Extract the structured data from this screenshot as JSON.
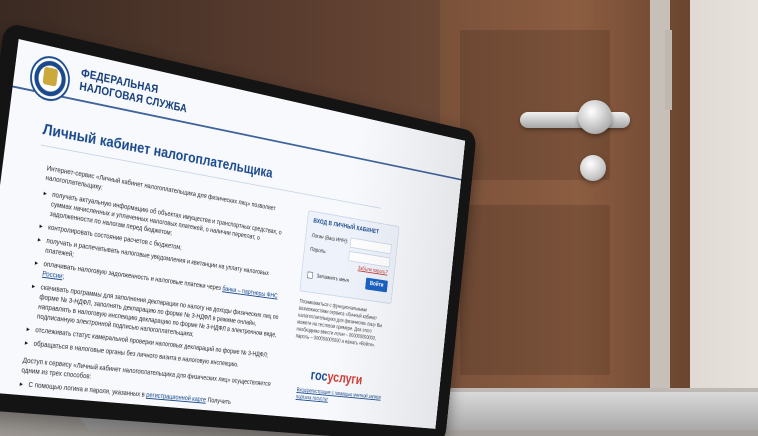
{
  "site": {
    "brand_line1": "ФЕДЕРАЛЬНАЯ",
    "brand_line2": "НАЛОГОВАЯ СЛУЖБА",
    "page_title": "Личный кабинет налогоплательщика"
  },
  "main": {
    "intro": "Интернет-сервис «Личный кабинет налогоплательщика для физических лиц» позволяет налогоплательщику:",
    "bullets": [
      "получать актуальную информацию об объектах имущества и транспортных средствах, о суммах начисленных и уплаченных налоговых платежей, о наличии переплат, о задолженности по налогам перед бюджетом;",
      "контролировать состояние расчетов с бюджетом;",
      "получать и распечатывать налоговые уведомления и квитанции на уплату налоговых платежей;",
      "оплачивать налоговую задолженность и налоговые платежи через банки – партнеры ФНС России;",
      "скачивать программы для заполнения декларации по налогу на доходы физических лиц по форме № 3-НДФЛ, заполнять декларацию по форме № 3-НДФЛ в режиме онлайн, направлять в налоговую инспекцию декларацию по форме № 3-НДФЛ в электронном виде, подписанную электронной подписью налогоплательщика;",
      "отслеживать статус камеральной проверки налоговых деклараций по форме № 3-НДФЛ;",
      "обращаться в налоговые органы без личного визита в налоговую инспекцию."
    ],
    "bullet4_link": "банки – партнеры ФНС России",
    "access_intro": "Доступ к сервису «Личный кабинет налогоплательщика для физических лиц» осуществляется одним из трех способов:",
    "access_bullet1_prefix": "С помощью логина и пароля, указанных в",
    "access_bullet1_link": "регистрационной карте",
    "access_bullet1_suffix": "Получить"
  },
  "login": {
    "title": "ВХОД В ЛИЧНЫЙ КАБИНЕТ",
    "login_label": "Логин (Ваш ИНН):",
    "password_label": "Пароль:",
    "forgot": "Забыли пароль?",
    "remember": "Запомнить меня",
    "button": "Войти",
    "login_value": "",
    "password_value": ""
  },
  "side": {
    "note": "Познакомиться с функциональными возможностями сервиса «Личный кабинет налогоплательщика для физических лиц» Вы можете на тестовом примере. Для этого необходимо ввести логин – 000000000000, пароль – 000000000000 и нажать «Войти».",
    "gosuslugi_part1": "гос",
    "gosuslugi_part2": "услуги",
    "gosuslugi_note": "Вход/регистрация с помощью учетной записи портала госуслуг"
  },
  "colors": {
    "brand_blue": "#1b4a8c",
    "button_blue": "#1c62c4",
    "link_red": "#c13a35",
    "gos_red": "#d43a34"
  }
}
